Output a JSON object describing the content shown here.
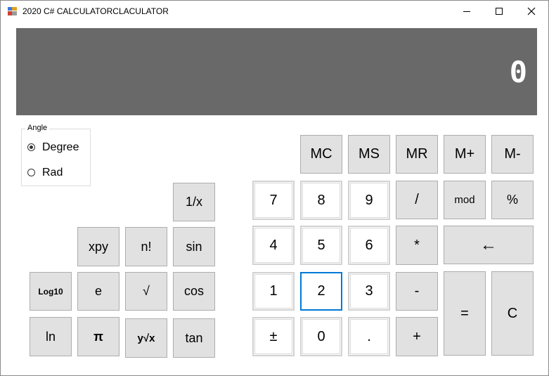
{
  "window": {
    "title": "2020 C# CALCULATORCLACULATOR"
  },
  "display": {
    "value": "0",
    "background": "#696969"
  },
  "angle": {
    "legend": "Angle",
    "options": [
      "Degree",
      "Rad"
    ],
    "selected": "Degree"
  },
  "buttons": {
    "mc": "MC",
    "ms": "MS",
    "mr": "MR",
    "mplus": "M+",
    "mminus": "M-",
    "seven": "7",
    "eight": "8",
    "nine": "9",
    "divide": "/",
    "mod": "mod",
    "percent": "%",
    "four": "4",
    "five": "5",
    "six": "6",
    "multiply": "*",
    "backspace": "←",
    "one": "1",
    "two": "2",
    "three": "3",
    "minus": "-",
    "equals": "=",
    "clear": "C",
    "plusminus": "±",
    "zero": "0",
    "dot": ".",
    "plus": "+",
    "reciprocal": "1/x",
    "xpy": "xpy",
    "factorial": "n!",
    "sin": "sin",
    "log10": "Log10",
    "e": "e",
    "sqrt": "√",
    "cos": "cos",
    "ln": "ln",
    "pi": "π",
    "root": "y√x",
    "tan": "tan"
  },
  "colors": {
    "focus": "#0078d7",
    "button_face": "#e1e1e1"
  }
}
